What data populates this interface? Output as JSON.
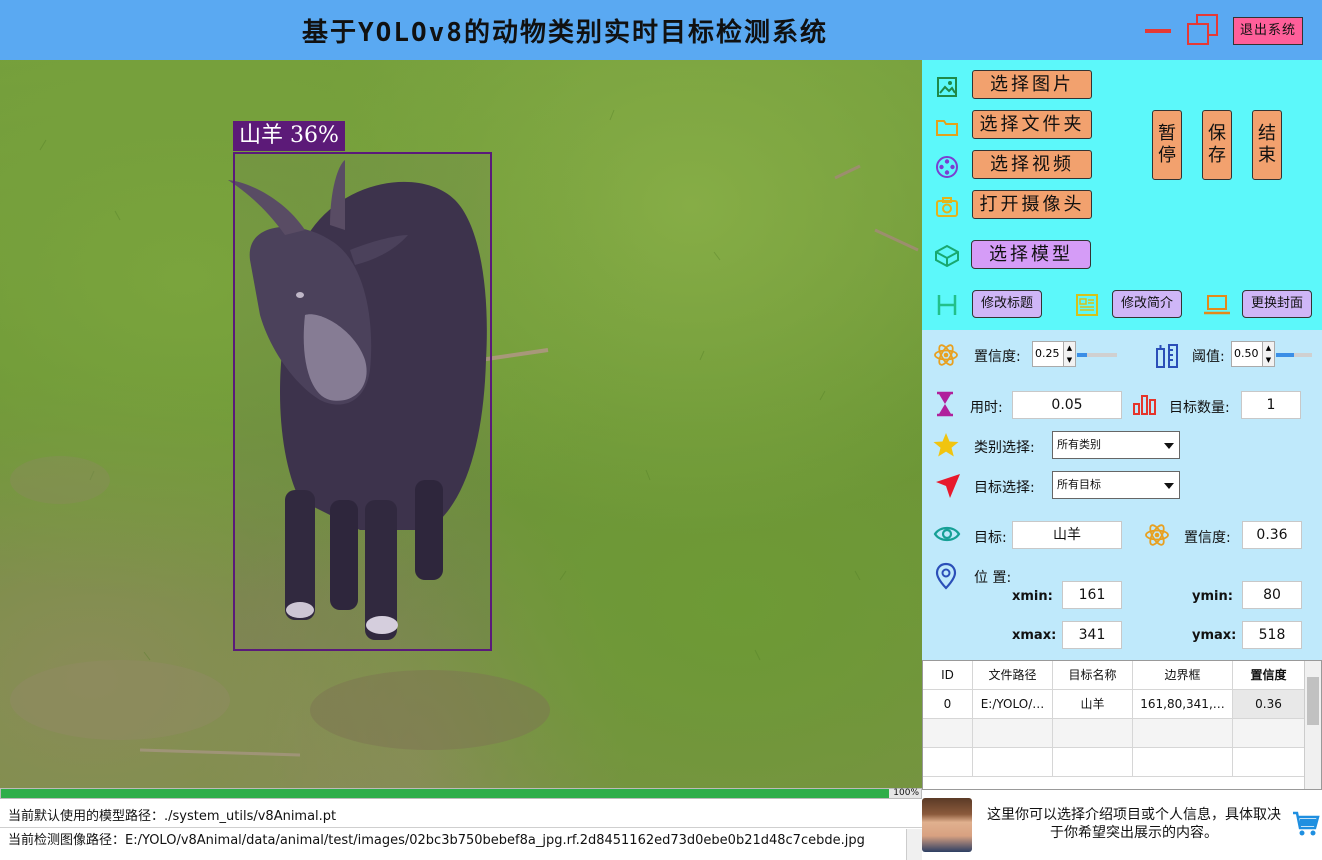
{
  "window": {
    "title": "基于YOLOv8的动物类别实时目标检测系统",
    "exit_label": "退出系统"
  },
  "detection": {
    "label": "山羊 36%"
  },
  "progress": {
    "value": 100,
    "text": "100%"
  },
  "status": {
    "model_path": "当前默认使用的模型路径：./system_utils/v8Animal.pt",
    "image_path": "当前检测图像路径：E:/YOLO/v8Animal/data/animal/test/images/02bc3b750bebef8a_jpg.rf.2d8451162ed73d0ebe0b21d48c7cebde.jpg"
  },
  "controls": {
    "select_image": "选择图片",
    "select_folder": "选择文件夹",
    "select_video": "选择视频",
    "open_camera": "打开摄像头",
    "select_model": "选择模型",
    "pause": "暂停",
    "save": "保存",
    "stop": "结束",
    "edit_title": "修改标题",
    "edit_intro": "修改简介",
    "change_cover": "更换封面"
  },
  "params": {
    "conf_label": "置信度:",
    "conf_value": "0.25",
    "conf_slider": 0.25,
    "iou_label": "阈值:",
    "iou_value": "0.50",
    "iou_slider": 0.5,
    "time_label": "用时:",
    "time_value": "0.05",
    "count_label": "目标数量:",
    "count_value": "1",
    "class_label": "类别选择:",
    "class_value": "所有类别",
    "target_label": "目标选择:",
    "target_value": "所有目标"
  },
  "result": {
    "target_label": "目标:",
    "target_value": "山羊",
    "conf_label": "置信度:",
    "conf_value": "0.36",
    "position_label": "位 置:",
    "xmin_label": "xmin:",
    "xmin": "161",
    "ymin_label": "ymin:",
    "ymin": "80",
    "xmax_label": "xmax:",
    "xmax": "341",
    "ymax_label": "ymax:",
    "ymax": "518"
  },
  "table": {
    "headers": [
      "ID",
      "文件路径",
      "目标名称",
      "边界框",
      "置信度"
    ],
    "rows": [
      [
        "0",
        "E:/YOLO/…",
        "山羊",
        "161,80,341,…",
        "0.36"
      ]
    ]
  },
  "intro": {
    "text": "这里你可以选择介绍项目或个人信息，具体取决于你希望突出展示的内容。"
  },
  "colors": {
    "titlebar": "#5aa9f2",
    "panel_top": "#5cf8fa",
    "panel_mid": "#bfe9fb",
    "orange_button": "#f2a16e",
    "purple_button": "#d59cf7",
    "box": "#5a1a7a"
  },
  "icons": {
    "image": "image-icon",
    "folder": "folder-icon",
    "video": "film-reel-icon",
    "camera": "camera-icon",
    "model": "cube-icon",
    "heading": "heading-icon",
    "document": "document-icon",
    "laptop": "laptop-icon",
    "atom": "atom-icon",
    "ruler": "ruler-icon",
    "hourglass": "hourglass-icon",
    "chart": "bar-chart-icon",
    "star": "star-icon",
    "pointer": "cursor-arrow-icon",
    "eye": "eye-icon",
    "location": "location-pin-icon",
    "cart": "cart-icon"
  }
}
